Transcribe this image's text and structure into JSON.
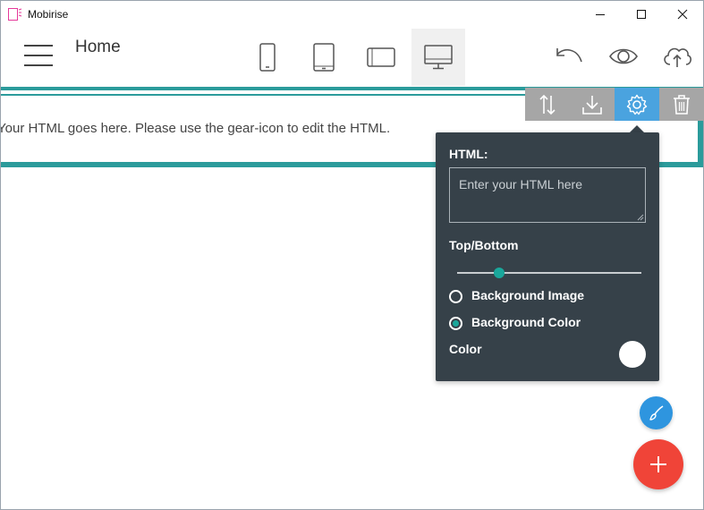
{
  "window": {
    "title": "Mobirise"
  },
  "toolbar": {
    "page_title": "Home",
    "active_device": "desktop"
  },
  "block": {
    "text": "Your HTML goes here. Please use the gear-icon to edit the HTML."
  },
  "settings_panel": {
    "html_label": "HTML:",
    "html_placeholder": "Enter your HTML here",
    "top_bottom_label": "Top/Bottom",
    "top_bottom_value": 0.23,
    "background_image_label": "Background Image",
    "background_color_label": "Background Color",
    "selected_background": "color",
    "color_label": "Color",
    "color_value": "#ffffff"
  },
  "colors": {
    "accent_teal": "#2b9b9b",
    "panel_bg": "#364149",
    "gear_active": "#4aa3df",
    "fab_brush": "#2e95df",
    "fab_add": "#f04438"
  }
}
